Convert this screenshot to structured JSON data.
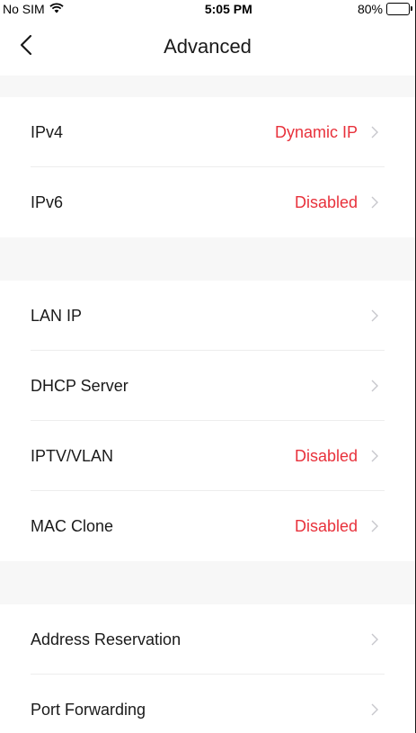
{
  "status_bar": {
    "carrier": "No SIM",
    "time": "5:05 PM",
    "battery_percent": "80%",
    "battery_level": 0.8,
    "wifi_icon": "wifi-icon"
  },
  "nav": {
    "back_icon": "chevron-left-icon",
    "title": "Advanced"
  },
  "colors": {
    "accent_red": "#e8313b",
    "section_gap": "#f7f7f7",
    "chevron": "#c7c7cc"
  },
  "groups": [
    {
      "rows": [
        {
          "label": "IPv4",
          "value": "Dynamic IP"
        },
        {
          "label": "IPv6",
          "value": "Disabled"
        }
      ]
    },
    {
      "rows": [
        {
          "label": "LAN IP",
          "value": ""
        },
        {
          "label": "DHCP Server",
          "value": ""
        },
        {
          "label": "IPTV/VLAN",
          "value": "Disabled"
        },
        {
          "label": "MAC Clone",
          "value": "Disabled"
        }
      ]
    },
    {
      "rows": [
        {
          "label": "Address Reservation",
          "value": ""
        },
        {
          "label": "Port Forwarding",
          "value": ""
        }
      ]
    }
  ]
}
